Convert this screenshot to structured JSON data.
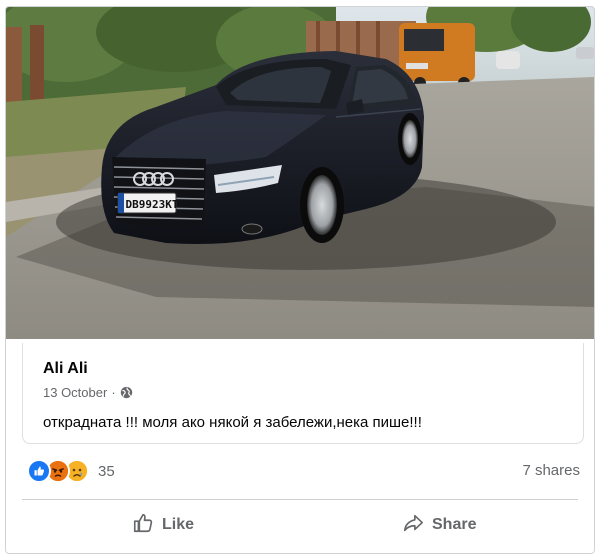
{
  "post": {
    "author": "Ali Ali",
    "date": "13 October",
    "separator": "·",
    "privacy_icon": "globe-icon",
    "text": "откраднатa !!! моля ако някой я забележи,нека пише!!!"
  },
  "photo": {
    "license_plate": "DB9923KT",
    "description_icon": "car-photo"
  },
  "engagement": {
    "reaction_icons": [
      "like-reaction-icon",
      "angry-reaction-icon",
      "sad-reaction-icon"
    ],
    "reaction_count": "35",
    "shares": "7 shares"
  },
  "actions": {
    "like_label": "Like",
    "share_label": "Share"
  },
  "colors": {
    "like_blue": "#1877f2",
    "angry_orange": "#e9710f",
    "sad_yellow": "#f7b125",
    "secondary_text": "#65676b"
  }
}
